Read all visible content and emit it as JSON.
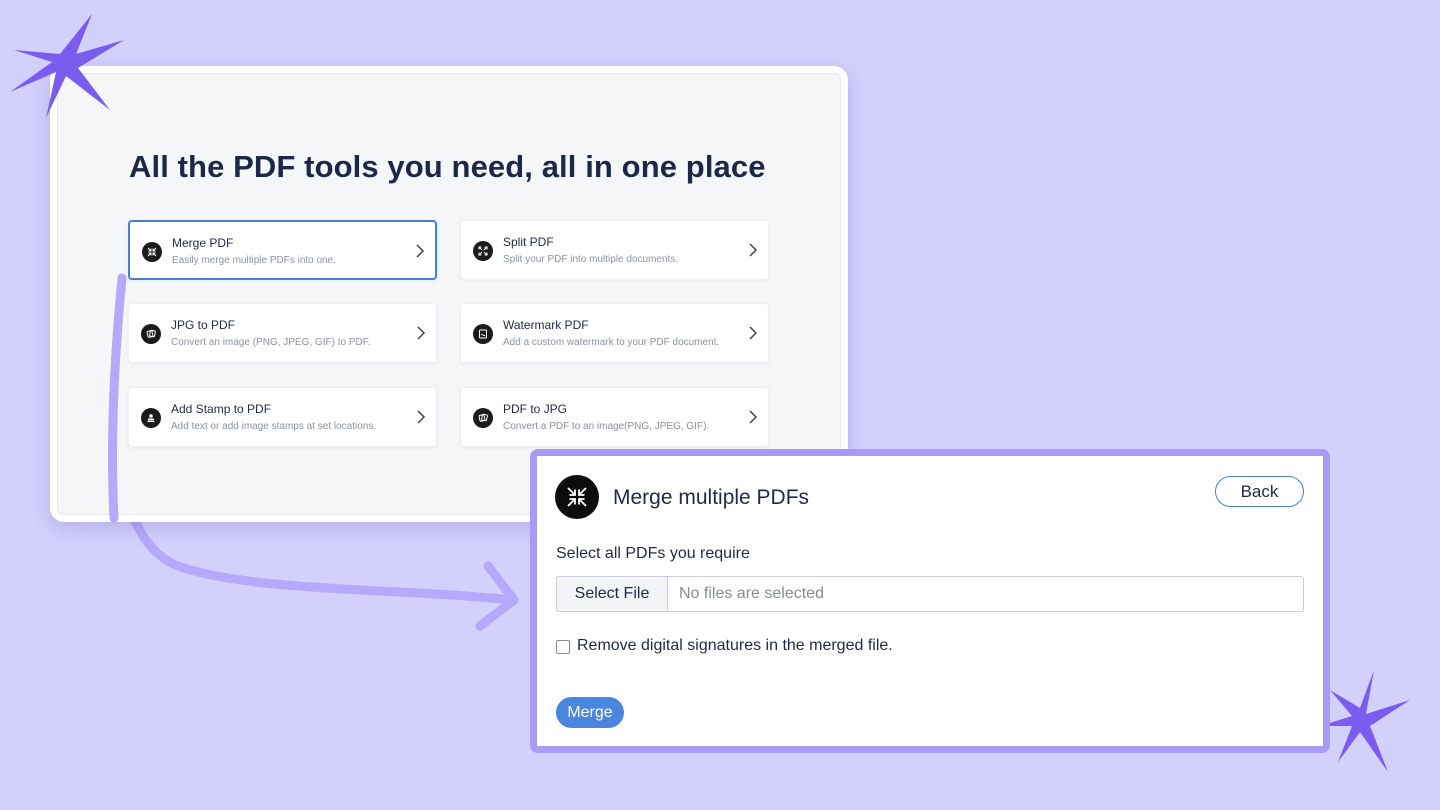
{
  "tools_panel": {
    "title": "All the PDF tools you need, all in one place",
    "cards": [
      {
        "name": "Merge PDF",
        "description": "Easily merge multiple PDFs into one.",
        "icon": "merge-icon",
        "active": true
      },
      {
        "name": "Split PDF",
        "description": "Split your PDF into multiple documents.",
        "icon": "split-icon",
        "active": false
      },
      {
        "name": "JPG to PDF",
        "description": "Convert an image (PNG, JPEG, GIF) to PDF.",
        "icon": "image-convert-icon",
        "active": false
      },
      {
        "name": "Watermark PDF",
        "description": "Add a custom watermark to your PDF document.",
        "icon": "watermark-icon",
        "active": false
      },
      {
        "name": "Add Stamp to PDF",
        "description": "Add text or add image stamps at set locations.",
        "icon": "stamp-icon",
        "active": false
      },
      {
        "name": "PDF to JPG",
        "description": "Convert a PDF to an image(PNG, JPEG, GIF).",
        "icon": "image-convert-icon",
        "active": false
      }
    ]
  },
  "merge_dialog": {
    "title": "Merge multiple PDFs",
    "back_label": "Back",
    "select_label": "Select all PDFs you require",
    "select_file_label": "Select File",
    "file_status": "No files are selected",
    "checkbox_label": "Remove digital signatures in the merged file.",
    "checkbox_checked": false,
    "merge_label": "Merge"
  },
  "colors": {
    "background": "#d3d0fc",
    "accent_blue": "#4a86e0",
    "dialog_border": "#a99af5",
    "sparkle": "#7b5cf0",
    "arrow": "#b6a9fb"
  }
}
